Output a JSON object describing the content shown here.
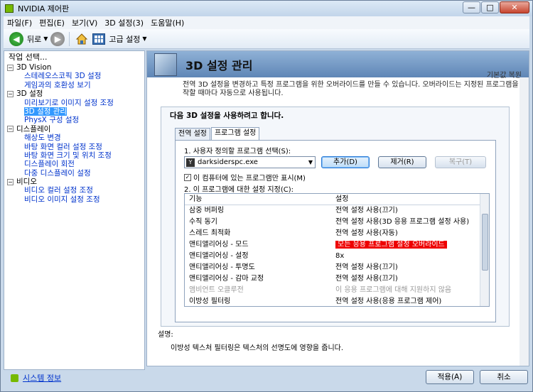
{
  "window": {
    "title": "NVIDIA 제어판",
    "min": "—",
    "max": "□",
    "close": "✕"
  },
  "menu": [
    "파일(F)",
    "편집(E)",
    "보기(V)",
    "3D 설정(3)",
    "도움말(H)"
  ],
  "toolbar": {
    "back_label": "뒤로",
    "advanced_label": "고급 설정"
  },
  "left": {
    "header": "작업 선택...",
    "tree": [
      {
        "label": "3D Vision",
        "children": [
          "스테레오스코픽 3D 설정",
          "게임과의 호환성 보기"
        ]
      },
      {
        "label": "3D 설정",
        "children": [
          "미리보기로 이미지 설정 조정",
          "3D 설정 관리",
          "PhysX 구성 설정"
        ]
      },
      {
        "label": "디스플레이",
        "children": [
          "해상도 변경",
          "바탕 화면 컬러 설정 조정",
          "바탕 화면 크기 및 위치 조정",
          "디스플레이 회전",
          "다중 디스플레이 설정"
        ]
      },
      {
        "label": "비디오",
        "children": [
          "비디오 컬러 설정 조정",
          "비디오 이미지 설정 조정"
        ]
      }
    ],
    "selected": "3D 설정 관리",
    "sysinfo": "시스템 정보"
  },
  "right": {
    "title": "3D 설정 관리",
    "restore_defaults": "기본값 복원",
    "description": "전역 3D 설정을 변경하고 특정 프로그램을 위한 오버라이드를 만들 수 있습니다. 오버라이드는 지정된 프로그램을 시작할 때마다 자동으로 사용됩니다.",
    "group_title": "다음 3D 설정을 사용하려고 합니다.",
    "tabs": [
      "전역 설정",
      "프로그램 설정"
    ],
    "step1": "1. 사용자 정의할 프로그램 선택(S):",
    "program": "darksiderspc.exe",
    "add": "추가(D)",
    "remove": "제거(R)",
    "restore": "복구(T)",
    "checkbox": "이 컴퓨터에 있는 프로그램만 표시(M)",
    "step2": "2. 이 프로그램에 대한 설정 지정(C):",
    "col_feature": "기능",
    "col_setting": "설정",
    "rows": [
      {
        "f": "삼중 버퍼링",
        "s": "전역 설정 사용(끄기)"
      },
      {
        "f": "수직 동기",
        "s": "전역 설정 사용(3D 응용 프로그램 설정 사용)"
      },
      {
        "f": "스레드 최적화",
        "s": "전역 설정 사용(자동)"
      },
      {
        "f": "앤티앨리어싱 - 모드",
        "s": "모든 응용 프로그램 설정 오버라이드"
      },
      {
        "f": "앤티앨리어싱 - 설정",
        "s": "8x"
      },
      {
        "f": "앤티앨리어싱 - 투명도",
        "s": "전역 설정 사용(끄기)"
      },
      {
        "f": "앤티앨리어싱 - 감마 교정",
        "s": "전역 설정 사용(끄기)"
      },
      {
        "f": "앰비언트 오클루전",
        "s": "이 응용 프로그램에 대해 지원하지 않음"
      },
      {
        "f": "이방성 필터링",
        "s": "전역 설정 사용(응용 프로그램 제어)"
      }
    ],
    "desc_label": "설명:",
    "desc_text": "이방성 텍스처 필터링은 텍스처의 선명도에 영향을 줍니다."
  },
  "bottom": {
    "apply": "적용(A)",
    "cancel": "취소"
  },
  "colors": {
    "highlight": "#ee0000",
    "selected": "#3399ff"
  }
}
